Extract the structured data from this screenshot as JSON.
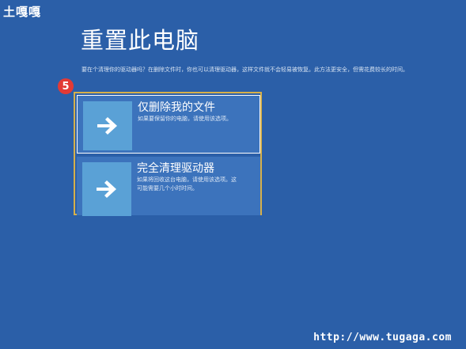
{
  "watermark": "土嘎嘎",
  "page": {
    "title": "重置此电脑",
    "description": "要在个清理你的驱动器吗？在删除文件时，你也可以清理驱动器，这样文件就不会轻易被恢复。此方法更安全，但需花费较长的时间。"
  },
  "step_badge": "5",
  "options": [
    {
      "title": "仅删除我的文件",
      "description": "如果要保留你的电脑，请使用该选项。",
      "icon": "arrow-right-icon"
    },
    {
      "title": "完全清理驱动器",
      "description": "如果将回收这台电脑，请使用该选项。这可能需要几个小时时间。",
      "icon": "arrow-right-icon"
    }
  ],
  "footer": {
    "url": "http://www.tugaga.com"
  },
  "colors": {
    "background": "#2b5fa8",
    "option_bg": "#3c73bc",
    "icon_tile": "#5aa1d6",
    "highlight": "#d6b04a",
    "badge": "#e23a35"
  }
}
